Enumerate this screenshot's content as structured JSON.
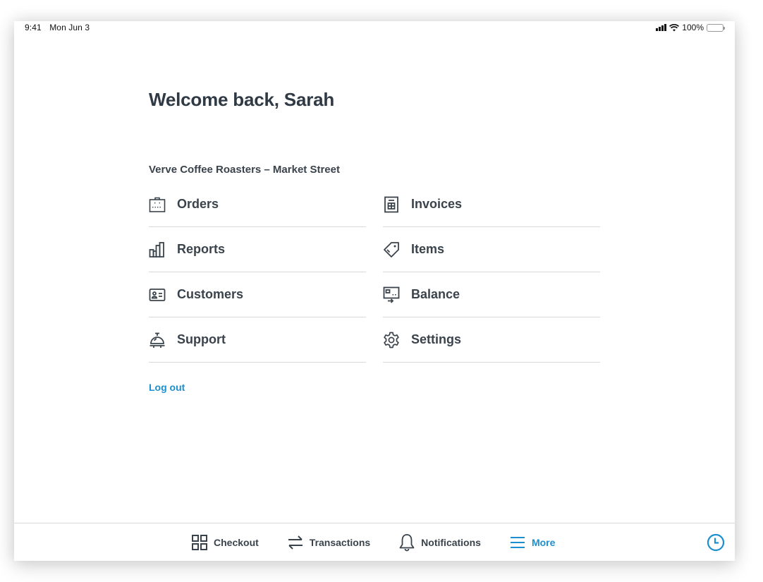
{
  "status_bar": {
    "time": "9:41",
    "date": "Mon Jun 3",
    "battery_percent": "100%",
    "icons": [
      "cellular-signal-icon",
      "wifi-icon",
      "battery-icon"
    ]
  },
  "header": {
    "welcome": "Welcome back, Sarah"
  },
  "location": {
    "name": "Verve Coffee Roasters – Market Street"
  },
  "menu": {
    "items": [
      {
        "label": "Orders",
        "icon": "shopping-bag-icon"
      },
      {
        "label": "Invoices",
        "icon": "invoice-icon"
      },
      {
        "label": "Reports",
        "icon": "bar-chart-icon"
      },
      {
        "label": "Items",
        "icon": "tag-icon"
      },
      {
        "label": "Customers",
        "icon": "contact-card-icon"
      },
      {
        "label": "Balance",
        "icon": "balance-transfer-icon"
      },
      {
        "label": "Support",
        "icon": "service-bell-icon"
      },
      {
        "label": "Settings",
        "icon": "gear-icon"
      }
    ]
  },
  "logout": {
    "label": "Log out"
  },
  "bottom_nav": {
    "tabs": [
      {
        "label": "Checkout",
        "icon": "grid-icon",
        "active": false
      },
      {
        "label": "Transactions",
        "icon": "swap-arrows-icon",
        "active": false
      },
      {
        "label": "Notifications",
        "icon": "bell-icon",
        "active": false
      },
      {
        "label": "More",
        "icon": "hamburger-menu-icon",
        "active": true
      }
    ],
    "clock_icon": "clock-icon"
  },
  "colors": {
    "accent": "#1d8ecf",
    "text": "#3a434c",
    "heading": "#2f3a45",
    "divider": "#d7d9db"
  }
}
